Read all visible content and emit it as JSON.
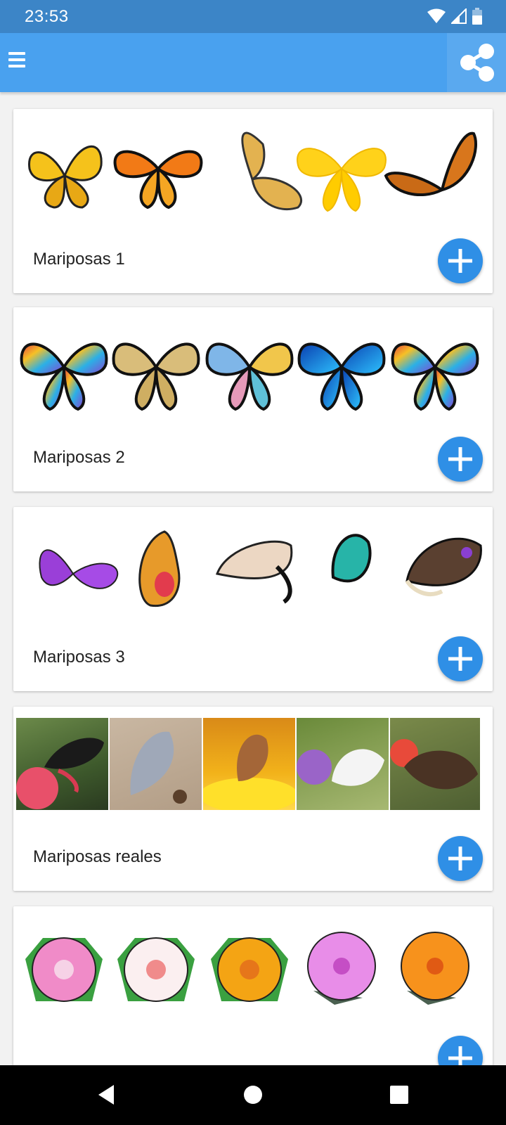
{
  "status_bar": {
    "time": "23:53",
    "icons": [
      "wifi-icon",
      "signal-icon",
      "battery-icon"
    ]
  },
  "app_bar": {
    "menu_icon": "menu-icon",
    "share_icon": "share-icon",
    "color": "#49a1ef"
  },
  "collections": [
    {
      "title": "Mariposas 1",
      "add_icon": "plus-icon"
    },
    {
      "title": "Mariposas 2",
      "add_icon": "plus-icon"
    },
    {
      "title": "Mariposas 3",
      "add_icon": "plus-icon"
    },
    {
      "title": "Mariposas reales",
      "add_icon": "plus-icon"
    },
    {
      "title": "",
      "add_icon": "plus-icon"
    }
  ],
  "nav_bar": {
    "buttons": [
      "back-icon",
      "home-icon",
      "recents-icon"
    ]
  },
  "colors": {
    "accent": "#2f8fe6",
    "status_bar": "#3c85c7"
  }
}
